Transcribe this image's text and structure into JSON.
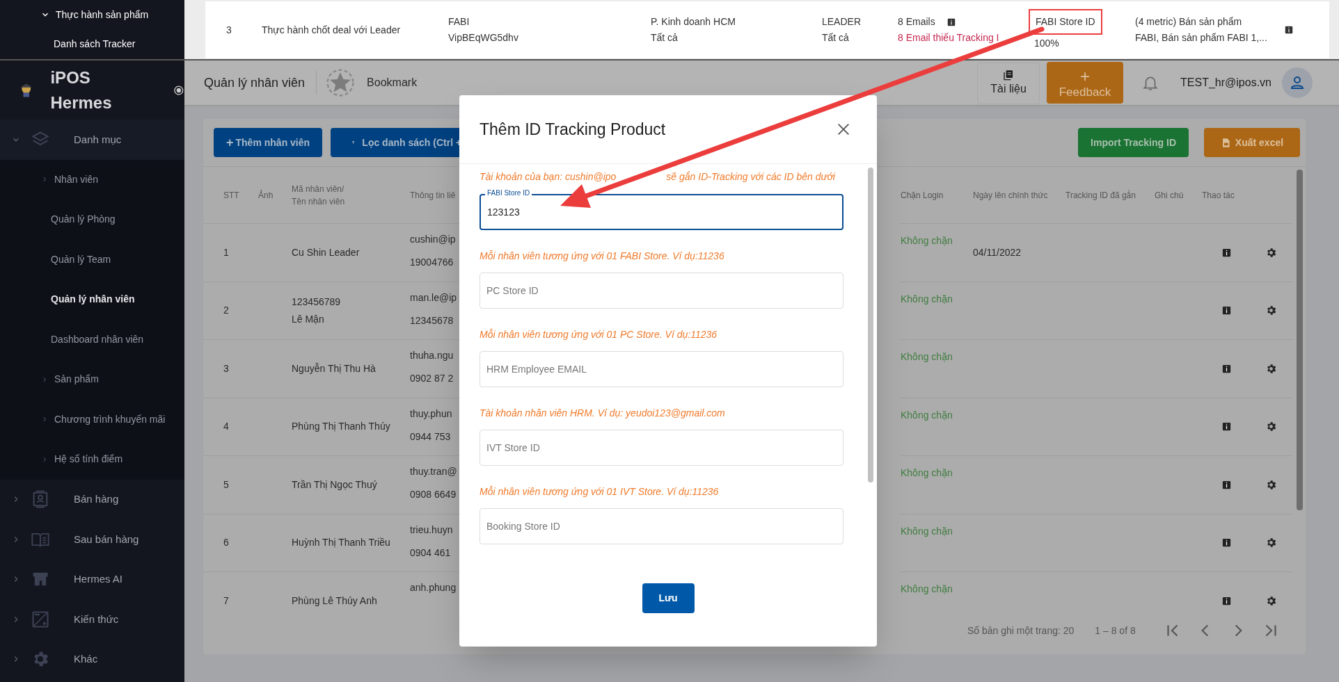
{
  "background_screenshot": {
    "sidebar_items": [
      {
        "label": "Thực hành sản phẩm",
        "expanded": true
      },
      {
        "label": "Danh sách Tracker",
        "expanded": false
      }
    ],
    "row": {
      "stt": "3",
      "title": "Thực hành chốt deal với Leader",
      "source": [
        "FABI",
        "VipBEqWG5dhv"
      ],
      "department": [
        "P. Kinh doanh HCM",
        "Tất cả"
      ],
      "role": [
        "LEADER",
        "Tất cả"
      ],
      "emails": "8 Emails",
      "missing": "8 Email thiếu Tracking I",
      "store": "FABI Store ID",
      "percent": "100%",
      "metric": [
        "(4 metric) Bán sản phẩm",
        "FABI, Bán sản phẩm FABI 1,..."
      ]
    }
  },
  "app": {
    "brand": "iPOS Hermes",
    "sidebar": [
      {
        "label": "Danh mục",
        "kind": "group",
        "expanded": true,
        "children": [
          {
            "label": "Nhân viên",
            "kind": "group",
            "expanded": false
          },
          {
            "label": "Quản lý Phòng",
            "kind": "link",
            "selected": false
          },
          {
            "label": "Quản lý Team",
            "kind": "link",
            "selected": false
          },
          {
            "label": "Quản lý nhân viên",
            "kind": "link",
            "selected": true
          },
          {
            "label": "Dashboard nhân viên",
            "kind": "link",
            "selected": false
          },
          {
            "label": "Sản phẩm",
            "kind": "group",
            "expanded": false
          },
          {
            "label": "Chương trình khuyến mãi",
            "kind": "group",
            "expanded": false
          },
          {
            "label": "Hệ số tính điểm",
            "kind": "group",
            "expanded": false
          }
        ]
      },
      {
        "label": "Bán hàng",
        "kind": "group",
        "expanded": false
      },
      {
        "label": "Sau bán hàng",
        "kind": "group",
        "expanded": false
      },
      {
        "label": "Hermes AI",
        "kind": "group",
        "expanded": false
      },
      {
        "label": "Kiến thức",
        "kind": "group",
        "expanded": false
      },
      {
        "label": "Khác",
        "kind": "group",
        "expanded": false
      }
    ],
    "header": {
      "title": "Quản lý nhân viên",
      "bookmark": "Bookmark",
      "docs": "Tài liệu",
      "feedback_icon": "+",
      "feedback": "Feedback",
      "user": "TEST_hr@ipos.vn"
    },
    "toolbar": {
      "add": "Thêm nhân viên",
      "add_icon": "+",
      "filter": "Lọc danh sách (Ctrl +",
      "import": "Import Tracking ID",
      "export": "Xuất excel"
    },
    "table": {
      "columns_left": [
        "STT",
        "Ảnh",
        "Mã nhân viên/\nTên nhân viên",
        "Thông tin liê"
      ],
      "columns_right": [
        "Chặn Login",
        "Ngày lên chính thức",
        "Tracking ID đã gắn",
        "Ghi chú",
        "Thao tác"
      ],
      "rows": [
        {
          "stt": "1",
          "name": [
            "Cu Shin Leader"
          ],
          "contact": [
            "cushin@ip",
            "19004766"
          ],
          "login": "Không chặn",
          "start_date": "04/11/2022"
        },
        {
          "stt": "2",
          "name": [
            "123456789",
            "Lê Mận"
          ],
          "contact": [
            "man.le@ip",
            "12345678"
          ],
          "login": "Không chặn"
        },
        {
          "stt": "3",
          "name": [
            "Nguyễn Thị Thu Hà"
          ],
          "contact": [
            "thuha.ngu",
            "0902 87 2"
          ],
          "login": "Không chặn"
        },
        {
          "stt": "4",
          "name": [
            "Phùng Thị Thanh Thúy"
          ],
          "contact": [
            "thuy.phun",
            "0944 753"
          ],
          "login": "Không chặn"
        },
        {
          "stt": "5",
          "name": [
            "Trần Thị Ngọc Thuý"
          ],
          "contact": [
            "thuy.tran@",
            "0908 6649"
          ],
          "login": "Không chặn"
        },
        {
          "stt": "6",
          "name": [
            "Huỳnh Thị Thanh Triều"
          ],
          "contact": [
            "trieu.huyn",
            "0904 461"
          ],
          "login": "Không chặn"
        },
        {
          "stt": "7",
          "name": [
            "Phùng Lê Thúy Anh"
          ],
          "contact": [
            "anh.phung"
          ],
          "login": "Không chặn"
        }
      ]
    },
    "pagination": {
      "page_size": "Số bản ghi một trang: 20",
      "range": "1 – 8 of 8"
    }
  },
  "modal": {
    "title": "Thêm ID Tracking Product",
    "note": [
      "Tài khoản của bạn: cushin@ipo",
      "sẽ gắn ID-Tracking với các ID bên dưới"
    ],
    "fields": [
      {
        "label": "FABI Store ID",
        "value": "123123",
        "focused": true,
        "hint": "Mỗi nhân viên tương ứng với 01 FABI Store. Ví dụ:11236"
      },
      {
        "placeholder": "PC Store ID",
        "focused": false,
        "hint": "Mỗi nhân viên tương ứng với 01 PC Store. Ví dụ:11236"
      },
      {
        "placeholder": "HRM Employee EMAIL",
        "focused": false,
        "hint": "Tài khoản nhân viên HRM. Ví dụ: yeudoi123@gmail.com"
      },
      {
        "placeholder": "IVT Store ID",
        "focused": false,
        "hint": "Mỗi nhân viên tương ứng với 01 IVT Store. Ví dụ:11236"
      },
      {
        "placeholder": "Booking Store ID",
        "focused": false
      }
    ],
    "save": "Lưu"
  }
}
